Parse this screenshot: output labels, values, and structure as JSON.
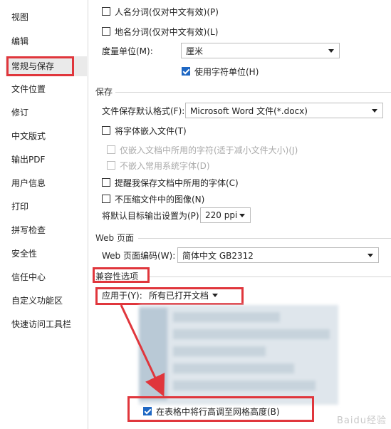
{
  "sidebar": {
    "items": [
      {
        "label": "视图"
      },
      {
        "label": "编辑"
      },
      {
        "label": "常规与保存"
      },
      {
        "label": "文件位置"
      },
      {
        "label": "修订"
      },
      {
        "label": "中文版式"
      },
      {
        "label": "输出PDF"
      },
      {
        "label": "用户信息"
      },
      {
        "label": "打印"
      },
      {
        "label": "拼写检查"
      },
      {
        "label": "安全性"
      },
      {
        "label": "信任中心"
      },
      {
        "label": "自定义功能区"
      },
      {
        "label": "快速访问工具栏"
      }
    ],
    "active_index": 2
  },
  "general": {
    "person_name_label": "人名分词(仅对中文有效)(P)",
    "place_name_label": "地名分词(仅对中文有效)(L)",
    "unit_label": "度量单位(M):",
    "unit_value": "厘米",
    "use_char_unit_label": "使用字符单位(H)"
  },
  "save": {
    "title": "保存",
    "default_format_label": "文件保存默认格式(F):",
    "default_format_value": "Microsoft Word 文件(*.docx)",
    "embed_fonts_label": "将字体嵌入文件(T)",
    "embed_used_only_label": "仅嵌入文档中所用的字符(适于减小文件大小)(J)",
    "no_common_fonts_label": "不嵌入常用系统字体(D)",
    "remind_fonts_label": "提醒我保存文档中所用的字体(C)",
    "no_compress_label": "不压缩文件中的图像(N)",
    "output_ppi_label": "将默认目标输出设置为(P):",
    "output_ppi_value": "220 ppi"
  },
  "web": {
    "title": "Web 页面",
    "encoding_label": "Web 页面编码(W):",
    "encoding_value": "简体中文 GB2312"
  },
  "compat": {
    "title": "兼容性选项",
    "apply_to_label": "应用于(Y):",
    "apply_to_value": "所有已打开文档",
    "grid_row_height_label": "在表格中将行高调至网格高度(B)"
  },
  "checkbox_states": {
    "person_name": false,
    "place_name": false,
    "use_char_unit": true,
    "embed_fonts": false,
    "embed_used_only": false,
    "no_common_fonts": false,
    "remind_fonts": false,
    "no_compress": false,
    "grid_row_height": true
  },
  "annotation_color": "#e0363c",
  "watermark": "Baidu经验"
}
